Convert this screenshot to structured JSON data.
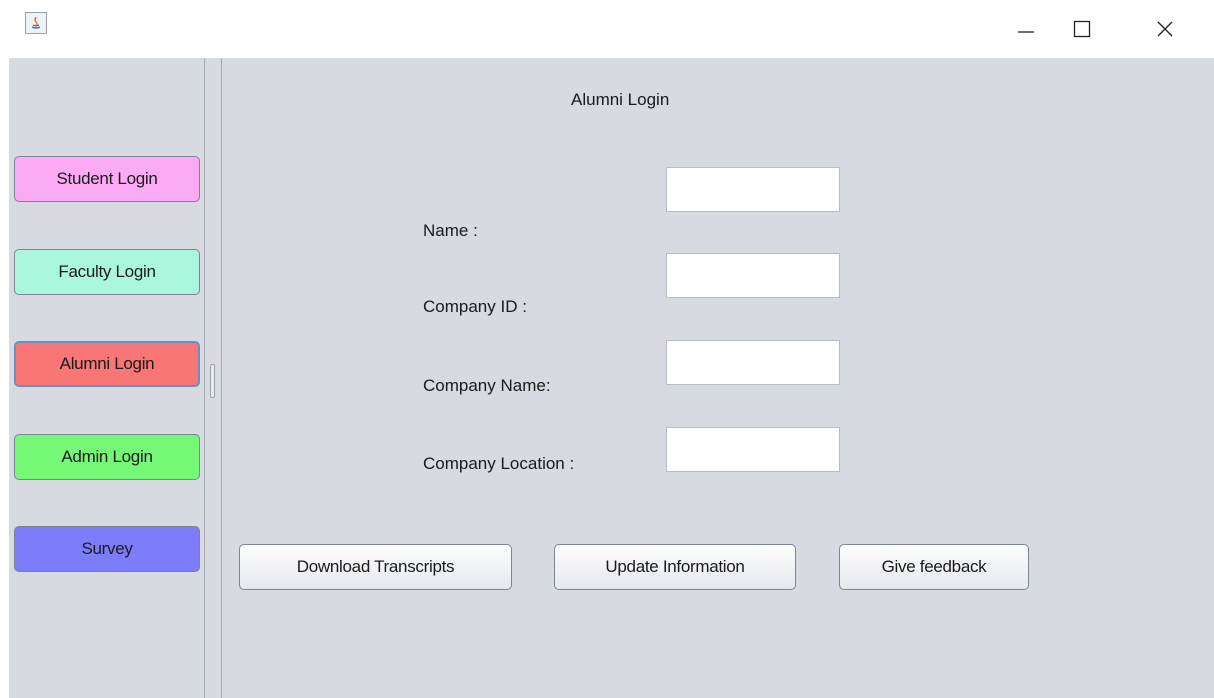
{
  "window": {
    "icon": "java-icon",
    "controls": [
      "minimize-icon",
      "maximize-icon",
      "close-icon"
    ]
  },
  "sidebar": {
    "items": [
      {
        "label": "Student Login",
        "color": "#fdaaf4"
      },
      {
        "label": "Faculty Login",
        "color": "#abf7de"
      },
      {
        "label": "Alumni Login",
        "color": "#f87676",
        "selected": true
      },
      {
        "label": "Admin Login",
        "color": "#74f876"
      },
      {
        "label": "Survey",
        "color": "#7d7dfb"
      }
    ]
  },
  "form": {
    "title": "Alumni Login",
    "fields": [
      {
        "label": "Name :",
        "value": ""
      },
      {
        "label": "Company ID :",
        "value": ""
      },
      {
        "label": "Company Name:",
        "value": ""
      },
      {
        "label": "Company Location :",
        "value": ""
      }
    ]
  },
  "actions": {
    "download_label": "Download Transcripts",
    "update_label": "Update Information",
    "feedback_label": "Give feedback"
  },
  "colors": {
    "panel_background": "#d7dae1"
  }
}
